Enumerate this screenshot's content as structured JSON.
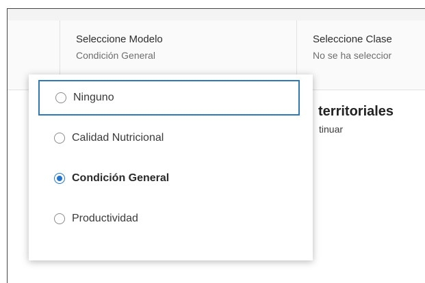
{
  "header": {
    "model": {
      "title": "Seleccione Modelo",
      "value": "Condición General"
    },
    "class": {
      "title": "Seleccione Clase",
      "value": "No se ha seleccior"
    }
  },
  "background": {
    "heading": "territoriales",
    "subtext": "tinuar"
  },
  "dropdown": {
    "options": [
      {
        "label": "Ninguno",
        "selected": false,
        "focused": true
      },
      {
        "label": "Calidad Nutricional",
        "selected": false,
        "focused": false
      },
      {
        "label": "Condición General",
        "selected": true,
        "focused": false
      },
      {
        "label": "Productividad",
        "selected": false,
        "focused": false
      }
    ]
  },
  "colors": {
    "accent": "#2074d4",
    "focus_border": "#2f78b6"
  }
}
